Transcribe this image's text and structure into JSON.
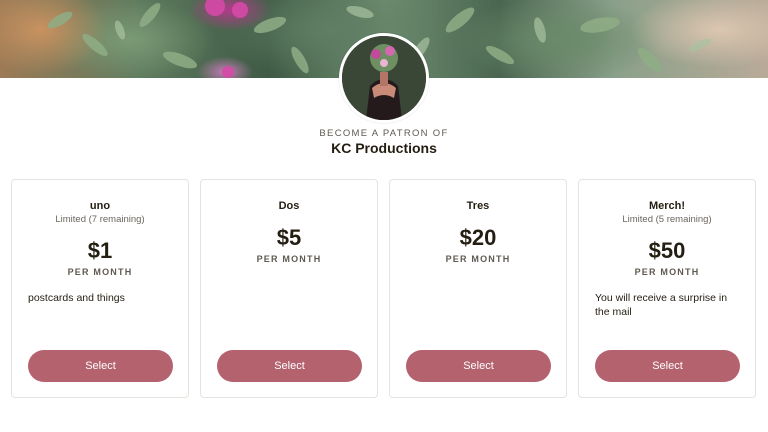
{
  "header": {
    "become_label": "BECOME A PATRON OF",
    "creator_name": "KC Productions"
  },
  "tiers": [
    {
      "name": "uno",
      "limit": "Limited (7 remaining)",
      "price": "$1",
      "period": "PER MONTH",
      "description": "postcards and things",
      "button_label": "Select"
    },
    {
      "name": "Dos",
      "limit": "",
      "price": "$5",
      "period": "PER MONTH",
      "description": "",
      "button_label": "Select"
    },
    {
      "name": "Tres",
      "limit": "",
      "price": "$20",
      "period": "PER MONTH",
      "description": "",
      "button_label": "Select"
    },
    {
      "name": "Merch!",
      "limit": "Limited (5 remaining)",
      "price": "$50",
      "period": "PER MONTH",
      "description": "You will receive a surprise in the mail",
      "button_label": "Select"
    }
  ],
  "colors": {
    "button": "#b5626f",
    "text": "#241e12",
    "card_border": "#e5e3dd"
  }
}
